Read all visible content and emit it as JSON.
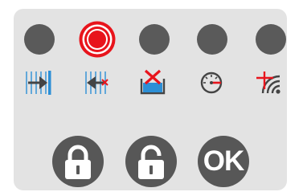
{
  "indicators": [
    {
      "id": "1",
      "state": "off",
      "color": "#5a5a5a"
    },
    {
      "id": "2",
      "state": "alarm",
      "color": "#e8141c"
    },
    {
      "id": "3",
      "state": "off",
      "color": "#5a5a5a"
    },
    {
      "id": "4",
      "state": "off",
      "color": "#5a5a5a"
    },
    {
      "id": "5",
      "state": "off",
      "color": "#5a5a5a"
    }
  ],
  "icons": [
    "door-closing-icon",
    "door-opening-icon",
    "tank-fault-icon",
    "speed-gauge-icon",
    "wireless-signal-fault-icon"
  ],
  "buttons": {
    "lock": {
      "icon": "lock-closed-icon"
    },
    "unlock": {
      "icon": "lock-open-icon"
    },
    "ok": {
      "label": "OK"
    }
  },
  "colors": {
    "panel": "#e3e3e3",
    "led_off": "#5a5a5a",
    "alarm_red": "#e8141c",
    "icon_blue": "#2c8fd6",
    "icon_dark": "#444444",
    "button": "#575757"
  }
}
